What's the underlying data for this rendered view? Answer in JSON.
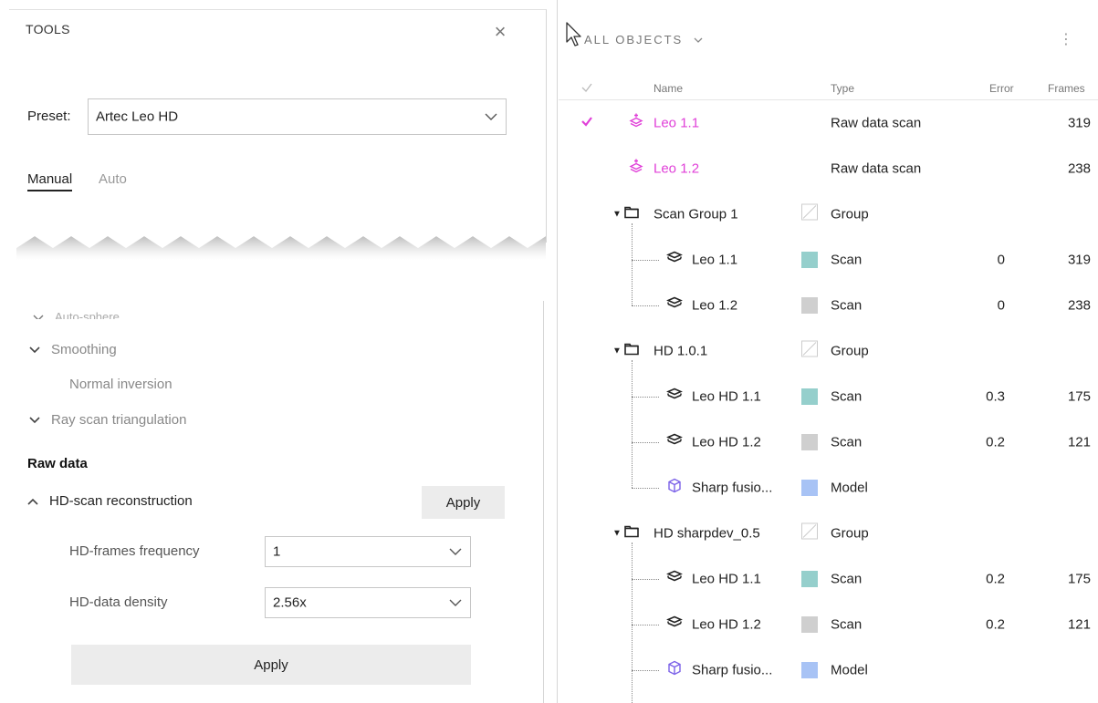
{
  "tools_panel": {
    "title": "TOOLS",
    "preset_label": "Preset:",
    "preset_value": "Artec Leo HD",
    "tabs": [
      "Manual",
      "Auto"
    ],
    "partial_option": "Auto-sphere ...",
    "options": [
      {
        "label": "Smoothing",
        "collapsible": true
      },
      {
        "label": "Normal inversion",
        "collapsible": false
      },
      {
        "label": "Ray scan triangulation",
        "collapsible": true
      }
    ],
    "raw_data_heading": "Raw data",
    "hd_reconstruction": "HD-scan reconstruction",
    "apply_small_label": "Apply",
    "frames_frequency_label": "HD-frames frequency",
    "frames_frequency_value": "1",
    "data_density_label": "HD-data density",
    "data_density_value": "2.56x",
    "apply_label": "Apply"
  },
  "objects_panel": {
    "title": "ALL OBJECTS",
    "headers": {
      "name": "Name",
      "type": "Type",
      "error": "Error",
      "frames": "Frames"
    },
    "rows": [
      {
        "name": "Leo 1.1",
        "type": "Raw data scan",
        "error": "",
        "frames": "319",
        "checked": true,
        "kind": "raw"
      },
      {
        "name": "Leo 1.2",
        "type": "Raw data scan",
        "error": "",
        "frames": "238",
        "checked": false,
        "kind": "raw"
      },
      {
        "name": "Scan Group 1",
        "type": "Group",
        "error": "",
        "frames": "",
        "kind": "group"
      },
      {
        "name": "Leo 1.1",
        "type": "Scan",
        "error": "0",
        "frames": "319",
        "kind": "scan",
        "color": "#95cfcc"
      },
      {
        "name": "Leo 1.2",
        "type": "Scan",
        "error": "0",
        "frames": "238",
        "kind": "scan",
        "color": "#cfcfcf"
      },
      {
        "name": "HD 1.0.1",
        "type": "Group",
        "error": "",
        "frames": "",
        "kind": "group"
      },
      {
        "name": "Leo HD 1.1",
        "type": "Scan",
        "error": "0.3",
        "frames": "175",
        "kind": "scan",
        "color": "#95cfcc"
      },
      {
        "name": "Leo HD 1.2",
        "type": "Scan",
        "error": "0.2",
        "frames": "121",
        "kind": "scan",
        "color": "#cfcfcf"
      },
      {
        "name": "Sharp fusio...",
        "type": "Model",
        "error": "",
        "frames": "",
        "kind": "model",
        "color": "#a8c3f5"
      },
      {
        "name": "HD sharpdev_0.5",
        "type": "Group",
        "error": "",
        "frames": "",
        "kind": "group"
      },
      {
        "name": "Leo HD 1.1",
        "type": "Scan",
        "error": "0.2",
        "frames": "175",
        "kind": "scan",
        "color": "#95cfcc"
      },
      {
        "name": "Leo HD 1.2",
        "type": "Scan",
        "error": "0.2",
        "frames": "121",
        "kind": "scan",
        "color": "#cfcfcf"
      },
      {
        "name": "Sharp fusio...",
        "type": "Model",
        "error": "",
        "frames": "",
        "kind": "model",
        "color": "#a8c3f5"
      }
    ]
  },
  "colors": {
    "accent_pink": "#e040d8",
    "scan_teal": "#95cfcc",
    "scan_gray": "#cfcfcf",
    "model_blue": "#a8c3f5"
  }
}
